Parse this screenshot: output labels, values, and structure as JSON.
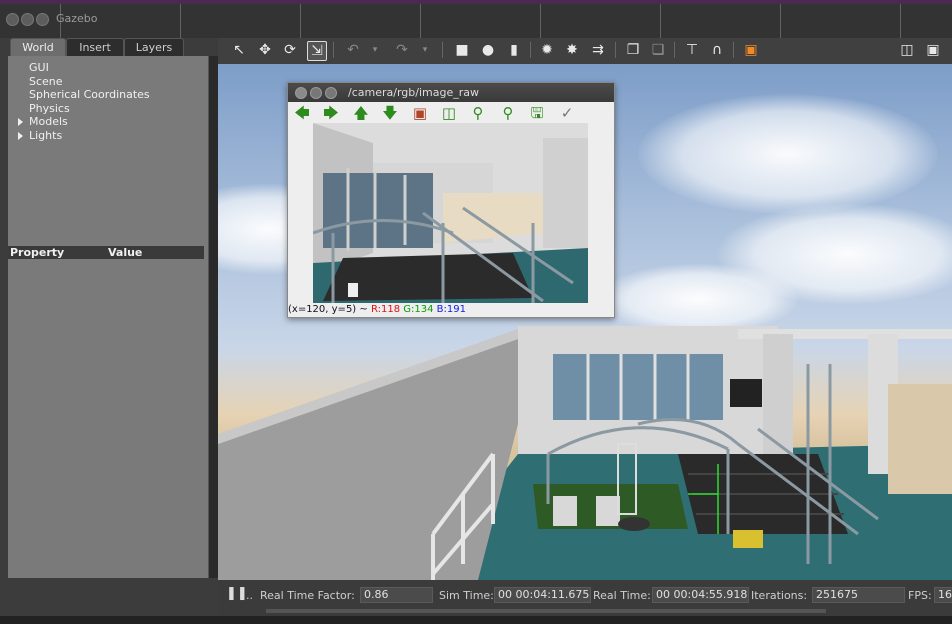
{
  "app": {
    "title": "Gazebo"
  },
  "left_panel": {
    "tabs": [
      {
        "label": "World",
        "active": true
      },
      {
        "label": "Insert",
        "active": false
      },
      {
        "label": "Layers",
        "active": false
      }
    ],
    "tree": [
      {
        "label": "GUI",
        "expandable": false
      },
      {
        "label": "Scene",
        "expandable": false
      },
      {
        "label": "Spherical Coordinates",
        "expandable": false
      },
      {
        "label": "Physics",
        "expandable": false
      },
      {
        "label": "Models",
        "expandable": true
      },
      {
        "label": "Lights",
        "expandable": true
      }
    ],
    "property_header": {
      "property": "Property",
      "value": "Value"
    }
  },
  "toolbar": {
    "icons": [
      "select-arrow-icon",
      "translate-icon",
      "rotate-icon",
      "scale-icon",
      "undo-icon",
      "undo-dropdown-icon",
      "redo-icon",
      "redo-dropdown-icon",
      "box-shape-icon",
      "sphere-shape-icon",
      "cylinder-shape-icon",
      "point-light-icon",
      "spot-light-icon",
      "directional-light-icon",
      "copy-icon",
      "paste-icon",
      "align-icon",
      "snap-icon",
      "change-view-icon",
      "screenshot-icon",
      "record-icon"
    ]
  },
  "image_view": {
    "title": "/camera/rgb/image_raw",
    "tools": [
      "go-back-icon",
      "go-forward-icon",
      "go-up-icon",
      "go-down-icon",
      "image-icon",
      "zoom-fit-icon",
      "zoom-in-icon",
      "zoom-out-icon",
      "save-icon",
      "clear-icon"
    ],
    "status": {
      "coords": "(x=120, y=5) ~ ",
      "r": "R:118",
      "g": "G:134",
      "b": "B:191",
      "r_color": "#e01010",
      "g_color": "#0a9a0a",
      "b_color": "#1020e0"
    }
  },
  "statusbar": {
    "pause_icon": "pause-icon",
    "step_label": "..",
    "real_time_factor_label": "Real Time Factor:",
    "real_time_factor": "0.86",
    "sim_time_label": "Sim Time:",
    "sim_time": "00 00:04:11.675",
    "real_time_label": "Real Time:",
    "real_time": "00 00:04:55.918",
    "iterations_label": "Iterations:",
    "iterations": "251675",
    "fps_label": "FPS:",
    "fps": "16"
  }
}
